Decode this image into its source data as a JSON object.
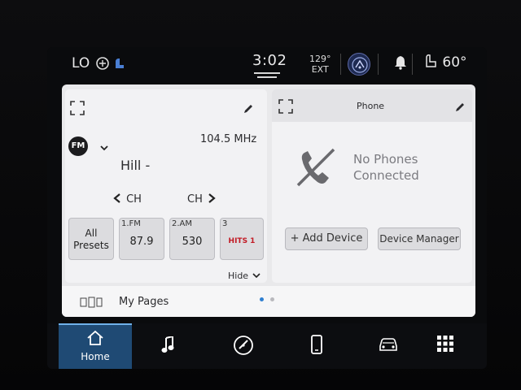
{
  "status_bar": {
    "fan_label": "LO",
    "time": "3:02",
    "ext_temp_value": "129°",
    "ext_temp_label": "EXT",
    "seat_temp": "60°"
  },
  "radio": {
    "band": "FM",
    "frequency": "104.5 MHz",
    "station_name": "Hill -",
    "prev_channel": "CH",
    "next_channel": "CH",
    "all_presets_line1": "All",
    "all_presets_line2": "Presets",
    "presets": [
      {
        "num": "1.FM",
        "value": "87.9"
      },
      {
        "num": "2.AM",
        "value": "530"
      },
      {
        "num": "3",
        "value": "HITS 1"
      }
    ],
    "hide_label": "Hide"
  },
  "phone": {
    "title": "Phone",
    "status_line1": "No Phones",
    "status_line2": "Connected",
    "add_device": "+ Add Device",
    "device_manager": "Device Manager"
  },
  "my_pages": {
    "label": "My Pages"
  },
  "nav": {
    "home_label": "Home"
  },
  "colors": {
    "active_nav": "#1f4a74",
    "accent_dot": "#2f7fd0",
    "panel_bg": "#f2f2f4"
  }
}
